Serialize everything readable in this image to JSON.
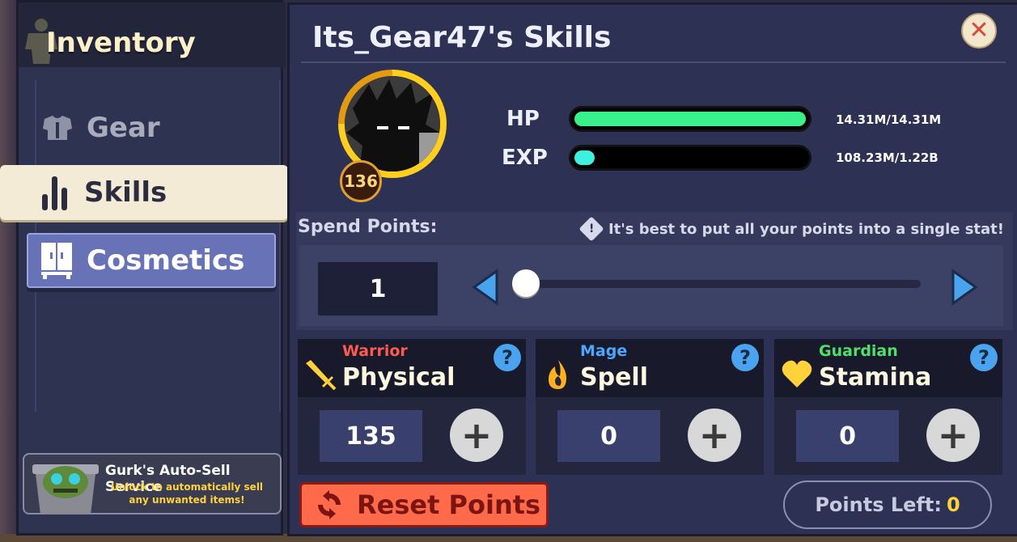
{
  "sidebar": {
    "title": "Inventory",
    "items": [
      {
        "label": "Gear",
        "icon": "armor-icon"
      },
      {
        "label": "Skills",
        "icon": "bar-chart-icon",
        "selected": true
      },
      {
        "label": "Cosmetics",
        "icon": "wardrobe-icon"
      }
    ],
    "promo": {
      "title": "Gurk's Auto-Sell Service",
      "subtitle_line1": "Unlock to automatically sell",
      "subtitle_line2": "any unwanted items!"
    }
  },
  "header": {
    "title": "Its_Gear47's Skills"
  },
  "player": {
    "level": "136",
    "hp": {
      "label": "HP",
      "value_text": "14.31M/14.31M",
      "fraction": 1.0,
      "color": "#39f08a"
    },
    "exp": {
      "label": "EXP",
      "value_text": "108.23M/1.22B",
      "fraction": 0.0887,
      "color": "#3ff0e0"
    }
  },
  "spend": {
    "title": "Spend Points:",
    "hint": "It's best to put all your points into a single stat!",
    "amount": "1",
    "slider_fraction": 0.0
  },
  "stats": [
    {
      "class_name": "Warrior",
      "class_color": "#ff5a4e",
      "name": "Physical",
      "value": "135",
      "icon": "sword-icon"
    },
    {
      "class_name": "Mage",
      "class_color": "#4aa8ff",
      "name": "Spell",
      "value": "0",
      "icon": "fire-icon"
    },
    {
      "class_name": "Guardian",
      "class_color": "#4fe06a",
      "name": "Stamina",
      "value": "0",
      "icon": "heart-icon"
    }
  ],
  "actions": {
    "reset_label": "Reset Points",
    "points_left_label": "Points Left:",
    "points_left_value": "0"
  }
}
